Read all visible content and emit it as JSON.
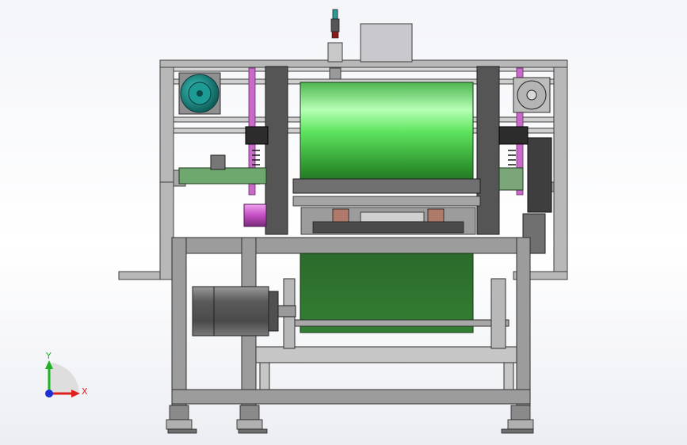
{
  "triad": {
    "x_label": "X",
    "y_label": "Y",
    "x_color": "#e0201a",
    "y_color": "#22b024",
    "z_color": "#1c2fd4"
  },
  "colors": {
    "frame_gray": "#9a9a9a",
    "frame_dark": "#505050",
    "roller_green": "#38d838",
    "belt_green": "#2d7a2d",
    "motor_teal": "#1c8f8a",
    "accent_magenta": "#c84fc8"
  }
}
